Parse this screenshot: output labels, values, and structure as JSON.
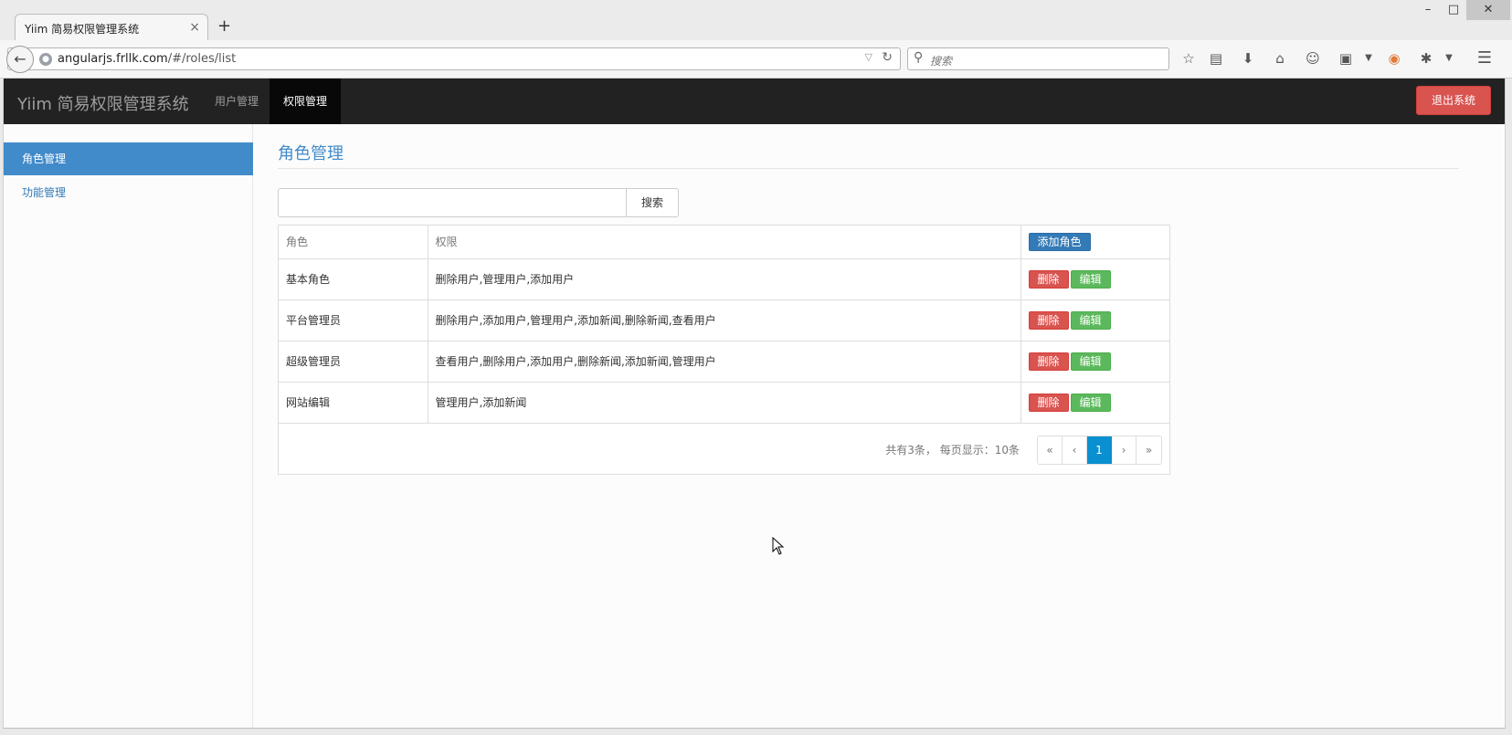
{
  "browser": {
    "tab_title": "Yiim 简易权限管理系统",
    "tab_close": "×",
    "new_tab": "+",
    "url_host": "angularjs.frllk.com",
    "url_path": "/#/roles/list",
    "search_placeholder": "搜索",
    "window_controls": {
      "minimize": "–",
      "maximize": "□",
      "close": "✕"
    }
  },
  "app": {
    "brand": "Yiim 简易权限管理系统",
    "nav": [
      {
        "label": "用户管理",
        "active": false
      },
      {
        "label": "权限管理",
        "active": true
      }
    ],
    "logout_label": "退出系统"
  },
  "sidebar": {
    "items": [
      {
        "label": "角色管理",
        "active": true
      },
      {
        "label": "功能管理",
        "active": false
      }
    ]
  },
  "main": {
    "title": "角色管理",
    "search_value": "",
    "search_button": "搜索",
    "table": {
      "headers": {
        "role": "角色",
        "permissions": "权限",
        "add_button": "添加角色"
      },
      "rows": [
        {
          "role": "基本角色",
          "permissions": "删除用户,管理用户,添加用户"
        },
        {
          "role": "平台管理员",
          "permissions": "删除用户,添加用户,管理用户,添加新闻,删除新闻,查看用户"
        },
        {
          "role": "超级管理员",
          "permissions": "查看用户,删除用户,添加用户,删除新闻,添加新闻,管理用户"
        },
        {
          "role": "网站编辑",
          "permissions": "管理用户,添加新闻"
        }
      ],
      "delete_label": "删除",
      "edit_label": "编辑"
    },
    "pagination": {
      "info": "共有3条， 每页显示：10条",
      "first": "«",
      "prev": "‹",
      "current": "1",
      "next": "›",
      "last": "»"
    }
  },
  "colors": {
    "header_bg": "#222222",
    "sidebar_active": "#428bca",
    "danger": "#d9534f",
    "success": "#5cb85c",
    "primary": "#337ab7",
    "page_active": "#0a8fd0"
  }
}
